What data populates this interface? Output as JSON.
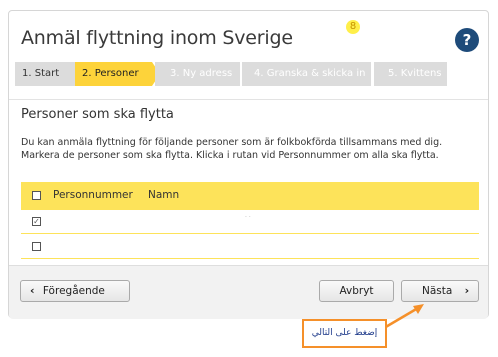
{
  "header": {
    "title": "Anmäl flyttning inom Sverige",
    "badge": "8",
    "help_label": "?"
  },
  "steps": [
    {
      "label": "1. Start",
      "state": "done"
    },
    {
      "label": "2. Personer",
      "state": "active"
    },
    {
      "label": "3. Ny adress",
      "state": "future"
    },
    {
      "label": "4. Granska & skicka in",
      "state": "future"
    },
    {
      "label": "5. Kvittens",
      "state": "future"
    }
  ],
  "section": {
    "title": "Personer som ska flytta",
    "description": "Du kan anmäla flyttning för följande personer som är folkbokförda tillsammans med dig. Markera de personer som ska flytta. Klicka i rutan vid Personnummer om alla ska flytta."
  },
  "table": {
    "columns": [
      "Personnummer",
      "Namn"
    ],
    "rows": [
      {
        "checked": true,
        "personnummer": "",
        "namn": ""
      },
      {
        "checked": false,
        "personnummer": "",
        "namn": ""
      }
    ]
  },
  "footer": {
    "prev_label": "Föregående",
    "cancel_label": "Avbryt",
    "next_label": "Nästa"
  },
  "annotation": {
    "text": "إضغط على التالي"
  },
  "colors": {
    "accent": "#fdd33a",
    "help": "#1e4b7a",
    "callout": "#f5902a"
  }
}
